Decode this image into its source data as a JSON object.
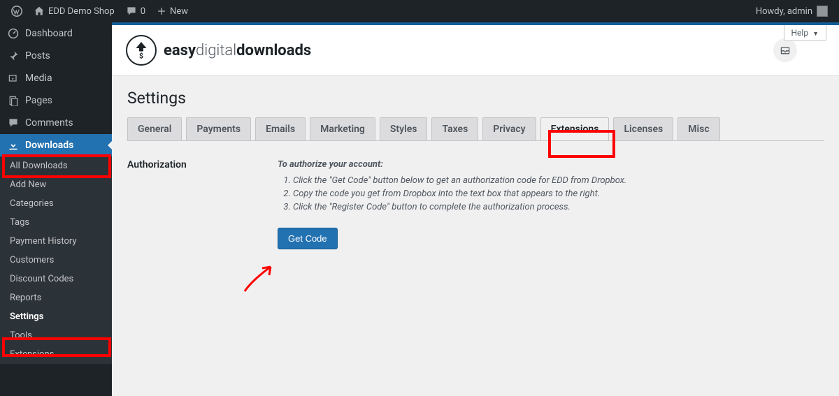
{
  "adminbar": {
    "site_name": "EDD Demo Shop",
    "comments_count": "0",
    "new_label": "New",
    "greeting": "Howdy, admin"
  },
  "sidebar": {
    "items": [
      {
        "label": "Dashboard",
        "icon": "dashboard"
      },
      {
        "label": "Posts",
        "icon": "pin"
      },
      {
        "label": "Media",
        "icon": "media"
      },
      {
        "label": "Pages",
        "icon": "pages"
      },
      {
        "label": "Comments",
        "icon": "comments"
      }
    ],
    "current": {
      "label": "Downloads",
      "icon": "download"
    },
    "submenu": [
      {
        "label": "All Downloads"
      },
      {
        "label": "Add New"
      },
      {
        "label": "Categories"
      },
      {
        "label": "Tags"
      },
      {
        "label": "Payment History"
      },
      {
        "label": "Customers"
      },
      {
        "label": "Discount Codes"
      },
      {
        "label": "Reports"
      },
      {
        "label": "Settings",
        "active": true
      },
      {
        "label": "Tools"
      },
      {
        "label": "Extensions"
      }
    ]
  },
  "brand": {
    "word1": "easy",
    "word2": "digital",
    "word3": "downloads"
  },
  "help_label": "Help",
  "page": {
    "title": "Settings",
    "tabs": [
      "General",
      "Payments",
      "Emails",
      "Marketing",
      "Styles",
      "Taxes",
      "Privacy",
      "Extensions",
      "Licenses",
      "Misc"
    ],
    "active_tab_index": 7
  },
  "form": {
    "section_label": "Authorization",
    "intro": "To authorize your account:",
    "steps": [
      "Click the \"Get Code\" button below to get an authorization code for EDD from Dropbox.",
      "Copy the code you get from Dropbox into the text box that appears to the right.",
      "Click the \"Register Code\" button to complete the authorization process."
    ],
    "button_label": "Get Code"
  }
}
